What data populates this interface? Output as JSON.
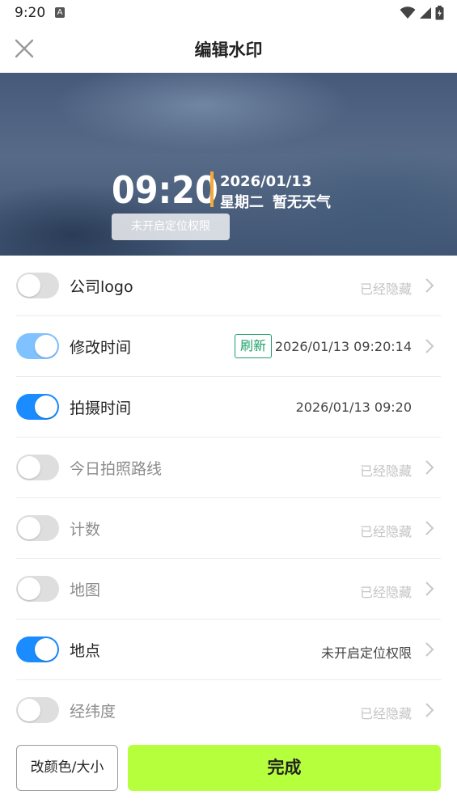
{
  "status_bar": {
    "time": "9:20",
    "badge": "A",
    "icons": [
      "wifi-icon",
      "signal-icon",
      "battery-icon"
    ]
  },
  "header": {
    "title": "编辑水印",
    "close_icon": "close-icon"
  },
  "watermark": {
    "time": "09:20",
    "date": "2026/01/13",
    "weekday": "星期二",
    "weather": "暂无天气",
    "location": "未开启定位权限",
    "accent_color": "#f3a93b"
  },
  "rows": [
    {
      "label": "公司logo",
      "value": "已经隐藏",
      "on": false
    },
    {
      "label": "修改时间",
      "badge": "刷新",
      "value": "2026/01/13 09:20:14",
      "on": true
    },
    {
      "label": "拍摄时间",
      "value": "2026/01/13 09:20",
      "on": true
    },
    {
      "label": "今日拍照路线",
      "value": "已经隐藏",
      "on": false
    },
    {
      "label": "计数",
      "value": "已经隐藏",
      "on": false
    },
    {
      "label": "地图",
      "value": "已经隐藏",
      "on": false
    },
    {
      "label": "地点",
      "value": "未开启定位权限",
      "on": true
    },
    {
      "label": "经纬度",
      "value": "已经隐藏",
      "on": false
    }
  ],
  "buttons": {
    "color_size": "改颜色/大小",
    "done": "完成"
  },
  "colors": {
    "toggle_on": "#1a8cff",
    "done_button": "#b6ff3c",
    "refresh_badge": "#1ea06a"
  }
}
